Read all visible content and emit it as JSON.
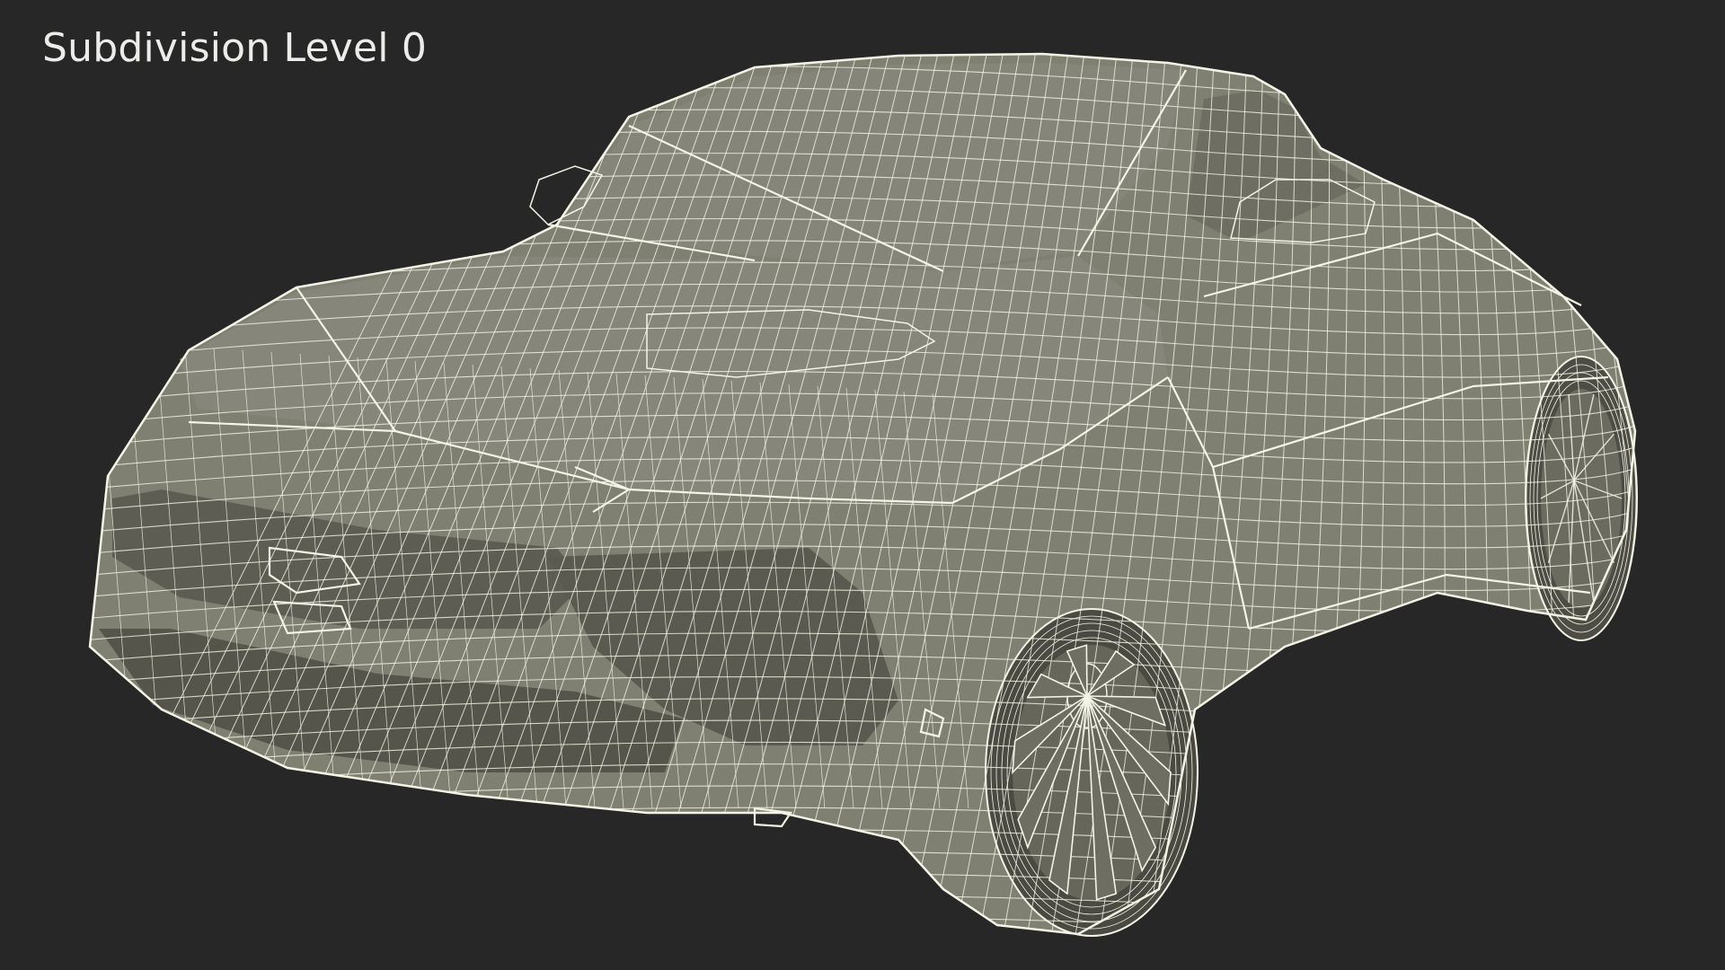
{
  "viewport": {
    "label": "Subdivision Level 0",
    "background": "#272727"
  },
  "model": {
    "icon": "car-wireframe-icon",
    "surface_color": "#7d7d70",
    "shadow_color": "#5f5f55",
    "wire_color": "#f4f4e6"
  }
}
